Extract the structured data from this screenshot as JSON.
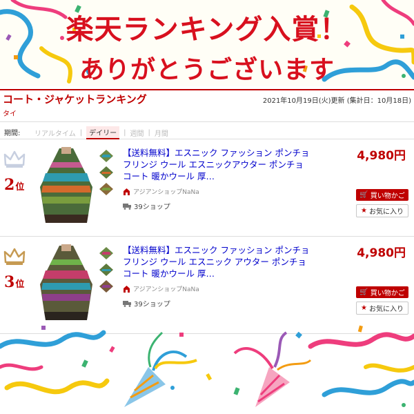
{
  "banner": {
    "line1": "楽天ランキング入賞！",
    "line2": "ありがとうございます"
  },
  "ranking": {
    "title": "コート・ジャケットランキング",
    "updated": "2021年10月19日(火)更新 (集計日：10月18日)",
    "genre_link": "タイ"
  },
  "period": {
    "label": "期間:",
    "tabs": [
      {
        "label": "リアルタイム",
        "active": false
      },
      {
        "label": "デイリー",
        "active": true
      },
      {
        "label": "週間",
        "active": false
      },
      {
        "label": "月間",
        "active": false
      }
    ]
  },
  "items": [
    {
      "rank": "2",
      "rank_suffix": "位",
      "crown_color": "#c7cfe0",
      "title": "【送料無料】エスニック ファッション ポンチョ フリンジ ウール エスニックアウター ポンチョコート 暖かウール 厚…",
      "price": "4,980円",
      "shop": "アジアンショップNaNa",
      "reviews": "39ショップ",
      "cart_label": "買い物かご",
      "fav_label": "お気に入り"
    },
    {
      "rank": "3",
      "rank_suffix": "位",
      "crown_color": "#c69a52",
      "title": "【送料無料】エスニック ファッション ポンチョ フリンジ ウール エスニック アウター ポンチョコート 暖かウール 厚…",
      "price": "4,980円",
      "shop": "アジアンショップNaNa",
      "reviews": "39ショップ",
      "cart_label": "買い物かご",
      "fav_label": "お気に入り"
    }
  ],
  "colors": {
    "accent": "#bf0000",
    "link": "#0000cc"
  },
  "icons": {
    "crown": "crown-icon",
    "shop": "shop-icon",
    "cart": "cart-icon",
    "star": "star-icon"
  }
}
